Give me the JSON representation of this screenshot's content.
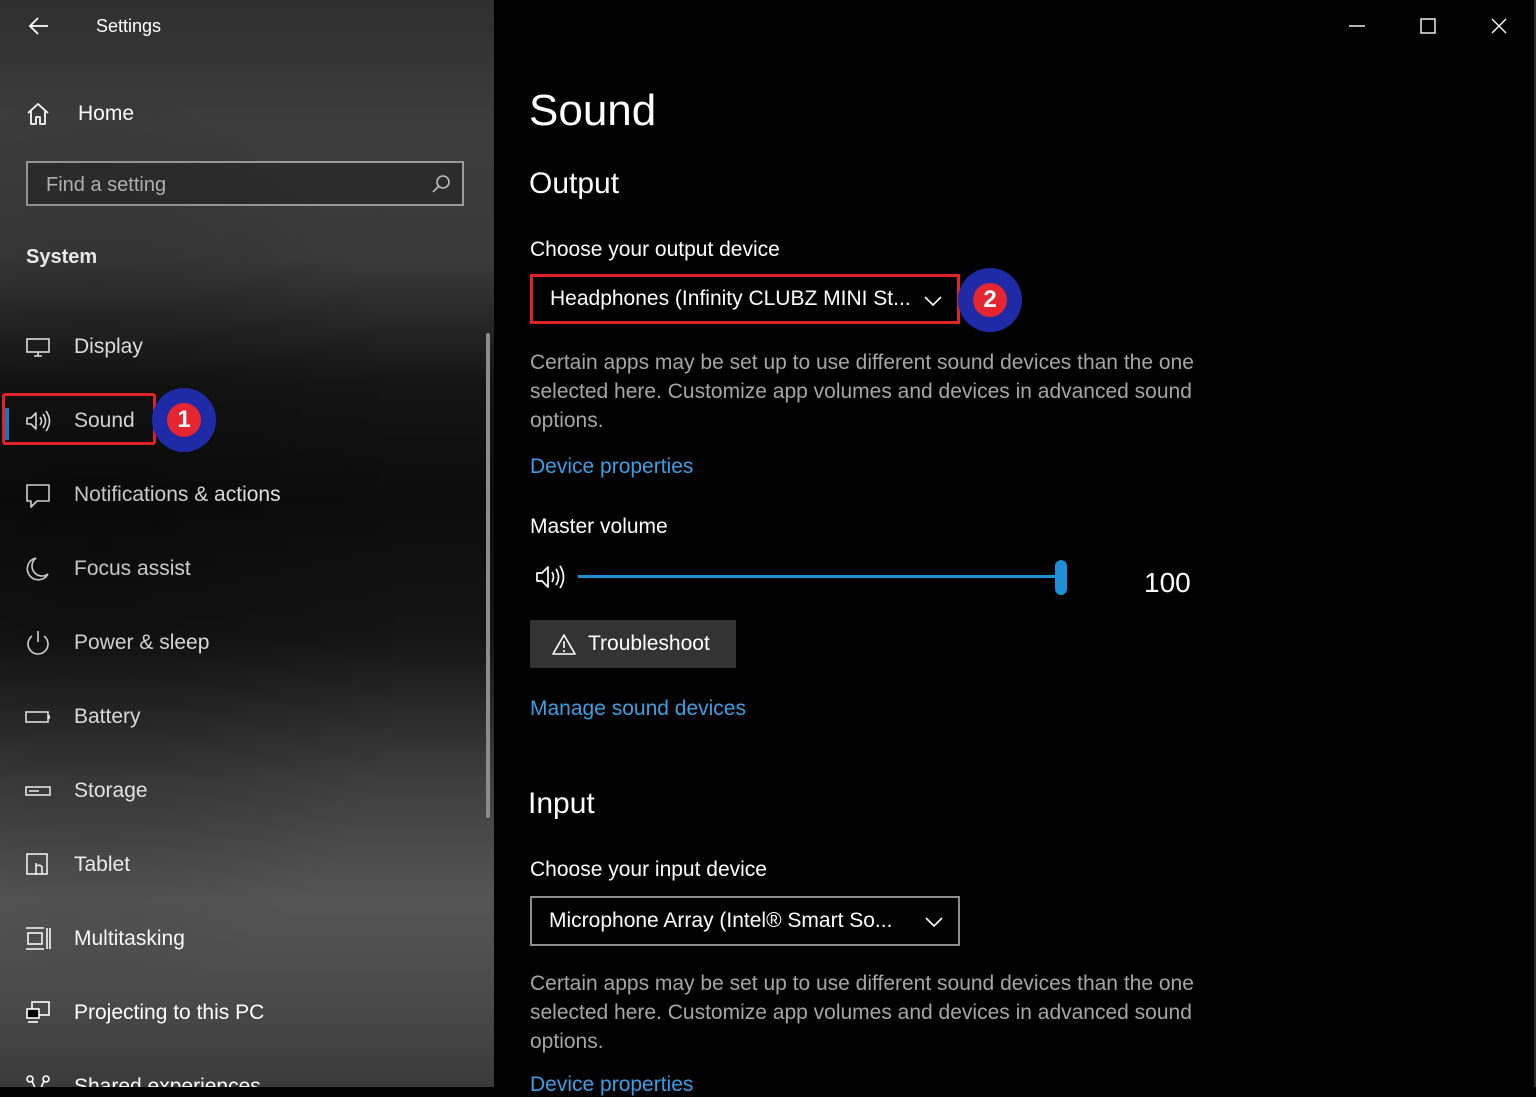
{
  "window": {
    "title": "Settings",
    "controls": [
      "minimize-icon",
      "maximize-icon",
      "close-icon"
    ]
  },
  "sidebar": {
    "home_label": "Home",
    "search_placeholder": "Find a setting",
    "section_header": "System",
    "items": [
      {
        "label": "Display",
        "icon": "display-icon"
      },
      {
        "label": "Sound",
        "icon": "speaker-icon",
        "selected": true
      },
      {
        "label": "Notifications & actions",
        "icon": "notification-icon"
      },
      {
        "label": "Focus assist",
        "icon": "moon-icon"
      },
      {
        "label": "Power & sleep",
        "icon": "power-icon"
      },
      {
        "label": "Battery",
        "icon": "battery-icon"
      },
      {
        "label": "Storage",
        "icon": "storage-icon"
      },
      {
        "label": "Tablet",
        "icon": "tablet-icon"
      },
      {
        "label": "Multitasking",
        "icon": "multitasking-icon"
      },
      {
        "label": "Projecting to this PC",
        "icon": "projecting-icon"
      },
      {
        "label": "Shared experiences",
        "icon": "shared-icon"
      }
    ]
  },
  "annotations": {
    "badge1": "1",
    "badge2": "2",
    "highlight_color": "#e02424",
    "badge_ring_color": "#1f2aa6",
    "badge_fill_color": "#e52630"
  },
  "main": {
    "title": "Sound",
    "output": {
      "heading": "Output",
      "device_label": "Choose your output device",
      "device_value": "Headphones (Infinity CLUBZ MINI St...",
      "description": "Certain apps may be set up to use different sound devices than the one selected here. Customize app volumes and devices in advanced sound options.",
      "device_properties_link": "Device properties",
      "master_volume_label": "Master volume",
      "master_volume_value": "100",
      "troubleshoot_label": "Troubleshoot",
      "manage_link": "Manage sound devices"
    },
    "input": {
      "heading": "Input",
      "device_label": "Choose your input device",
      "device_value": "Microphone Array (Intel® Smart So...",
      "description": "Certain apps may be set up to use different sound devices than the one selected here. Customize app volumes and devices in advanced sound options.",
      "device_properties_link": "Device properties"
    }
  },
  "colors": {
    "accent": "#1f8fd6",
    "link": "#3aa0e6",
    "description_text": "#a6a6a6"
  }
}
